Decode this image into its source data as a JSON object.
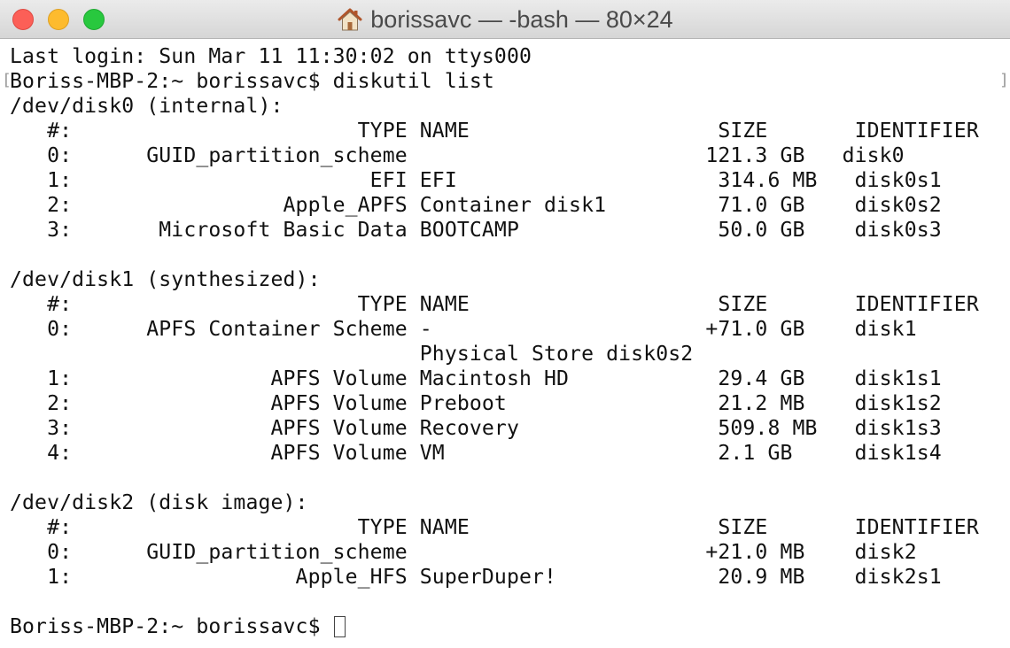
{
  "window": {
    "title": "borissavc — -bash — 80×24",
    "icon": "home-icon",
    "colors": {
      "close": "#fc5f57",
      "minimize": "#fdbb2e",
      "zoom": "#28c83e"
    }
  },
  "terminal": {
    "lines": [
      "Last login: Sun Mar 11 11:30:02 on ttys000",
      "Boriss-MBP-2:~ borissavc$ diskutil list",
      "/dev/disk0 (internal):",
      "   #:                       TYPE NAME                    SIZE       IDENTIFIER",
      "   0:      GUID_partition_scheme                        121.3 GB   disk0",
      "   1:                        EFI EFI                     314.6 MB   disk0s1",
      "   2:                 Apple_APFS Container disk1         71.0 GB    disk0s2",
      "   3:       Microsoft Basic Data BOOTCAMP                50.0 GB    disk0s3",
      "",
      "/dev/disk1 (synthesized):",
      "   #:                       TYPE NAME                    SIZE       IDENTIFIER",
      "   0:      APFS Container Scheme -                      +71.0 GB    disk1",
      "                                 Physical Store disk0s2",
      "   1:                APFS Volume Macintosh HD            29.4 GB    disk1s1",
      "   2:                APFS Volume Preboot                 21.2 MB    disk1s2",
      "   3:                APFS Volume Recovery                509.8 MB   disk1s3",
      "   4:                APFS Volume VM                      2.1 GB     disk1s4",
      "",
      "/dev/disk2 (disk image):",
      "   #:                       TYPE NAME                    SIZE       IDENTIFIER",
      "   0:      GUID_partition_scheme                        +21.0 MB    disk2",
      "   1:                  Apple_HFS SuperDuper!             20.9 MB    disk2s1",
      "",
      "Boriss-MBP-2:~ borissavc$ "
    ]
  }
}
